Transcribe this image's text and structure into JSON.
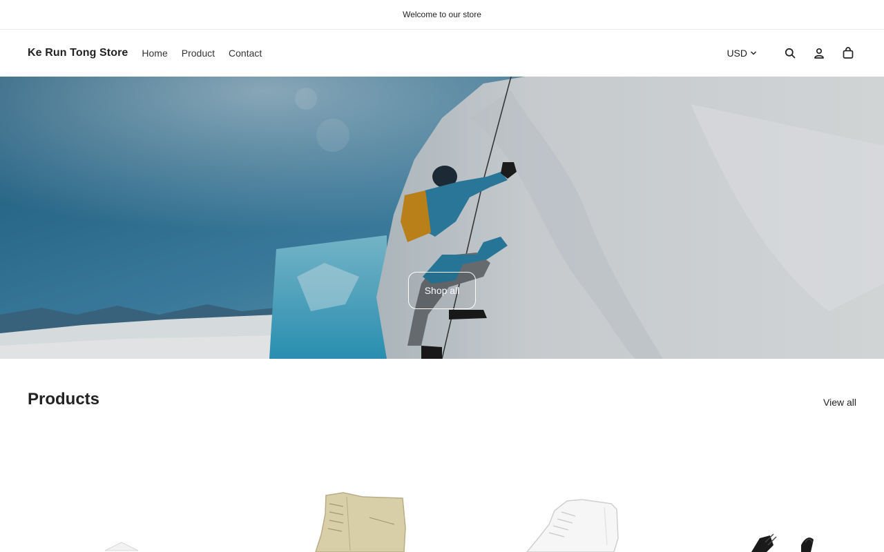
{
  "announcement": "Welcome to our store",
  "header": {
    "brand": "Ke Run Tong Store",
    "nav": [
      "Home",
      "Product",
      "Contact"
    ],
    "currency": "USD",
    "icons": [
      "search-icon",
      "account-icon",
      "cart-icon"
    ]
  },
  "hero": {
    "button_label": "Shop all"
  },
  "products_section": {
    "title": "Products",
    "view_all": "View all"
  },
  "colors": {
    "text": "#222222",
    "sky": "#2b6f93",
    "ice": "#d9dde0",
    "jacket": "#2b7fa3",
    "backpack": "#c98a1c"
  }
}
